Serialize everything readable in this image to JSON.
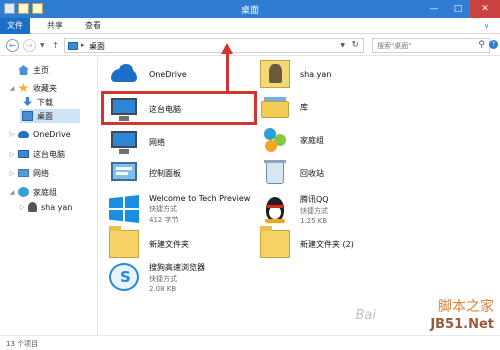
{
  "window": {
    "title": "桌面"
  },
  "ribbon": {
    "tabs": [
      {
        "label": "文件"
      },
      {
        "label": "共享"
      },
      {
        "label": "查看"
      }
    ]
  },
  "address": {
    "path": "桌面",
    "search_placeholder": "搜索\"桌面\""
  },
  "sidebar": {
    "items": [
      {
        "label": "主页",
        "icon": "home-icon"
      },
      {
        "label": "收藏夹",
        "icon": "star-icon"
      },
      {
        "label": "下载",
        "icon": "download-folder-icon"
      },
      {
        "label": "桌面",
        "icon": "desktop-folder-icon"
      },
      {
        "label": "OneDrive",
        "icon": "onedrive-icon"
      },
      {
        "label": "这台电脑",
        "icon": "computer-icon"
      },
      {
        "label": "网络",
        "icon": "network-icon"
      },
      {
        "label": "家庭组",
        "icon": "homegroup-icon"
      },
      {
        "label": "sha yan",
        "icon": "user-icon"
      }
    ]
  },
  "content": {
    "items": [
      {
        "name": "OneDrive",
        "icon": "onedrive-icon"
      },
      {
        "name": "sha yan",
        "icon": "user-folder-icon"
      },
      {
        "name": "这台电脑",
        "icon": "computer-icon"
      },
      {
        "name": "库",
        "icon": "library-icon"
      },
      {
        "name": "网络",
        "icon": "network-icon"
      },
      {
        "name": "家庭组",
        "icon": "homegroup-icon"
      },
      {
        "name": "控制面板",
        "icon": "control-panel-icon"
      },
      {
        "name": "回收站",
        "icon": "recycle-bin-icon"
      },
      {
        "name": "Welcome to Tech Preview",
        "sub1": "快捷方式",
        "sub2": "412 字节",
        "icon": "windows-logo-icon"
      },
      {
        "name": "腾讯QQ",
        "sub1": "快捷方式",
        "sub2": "1.25 KB",
        "icon": "qq-penguin-icon"
      },
      {
        "name": "新建文件夹",
        "icon": "folder-icon"
      },
      {
        "name": "新建文件夹 (2)",
        "icon": "folder-icon"
      },
      {
        "name": "搜狗高速浏览器",
        "sub1": "快捷方式",
        "sub2": "2.08 KB",
        "icon": "sogou-browser-icon"
      }
    ]
  },
  "status": {
    "count": "13 个项目"
  },
  "watermark": {
    "line1": "脚本之家",
    "line2": "JB51.Net",
    "baidu": "Bai"
  },
  "colors": {
    "titlebar": "#2f7dd3",
    "highlight": "#d2342f",
    "file_tab": "#1c6fc7"
  }
}
